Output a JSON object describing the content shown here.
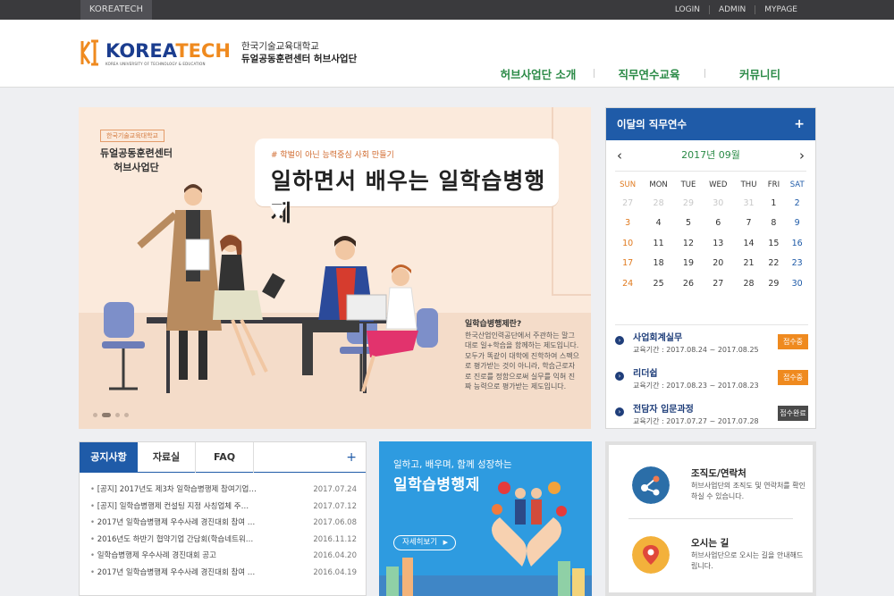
{
  "topbar": {
    "brand": "KOREATECH",
    "links": [
      "LOGIN",
      "ADMIN",
      "MYPAGE"
    ]
  },
  "logo": {
    "word_a": "KOREA",
    "word_b": "TECH",
    "sub": "KOREA UNIVERSITY OF TECHNOLOGY & EDUCATION",
    "kname1": "한국기술교육대학교",
    "kname2": "듀얼공동훈련센터 허브사업단"
  },
  "nav": [
    "허브사업단 소개",
    "직무연수교육",
    "커뮤니티"
  ],
  "hero": {
    "tag1": "한국기술교육대학교",
    "tag2a": "듀얼공동훈련센터",
    "tag2b": "허브사업단",
    "bubble_small": "# 학벌이 아닌 능력중심 사회 만들기",
    "bubble_big": "일하면서 배우는 일학습병행제",
    "info_title": "일학습병행제란?",
    "info_body": "한국산업인력공단에서 주관하는 말그대로 일+학습을 함께하는 제도입니다. 모두가 똑같이 대학에 진학하여 스펙으로 평가받는 것이 아니라, 학습근로자로 진로를 정함으로써 실무를 익혀 진짜 능력으로 평가받는 제도입니다."
  },
  "calendar": {
    "title": "이달의 직무연수",
    "plus": "+",
    "prev": "‹",
    "next": "›",
    "month": "2017년 09월",
    "days": [
      "SUN",
      "MON",
      "TUE",
      "WED",
      "THU",
      "FRI",
      "SAT"
    ],
    "weeks": [
      [
        "27",
        "28",
        "29",
        "30",
        "31",
        "1",
        "2"
      ],
      [
        "3",
        "4",
        "5",
        "6",
        "7",
        "8",
        "9"
      ],
      [
        "10",
        "11",
        "12",
        "13",
        "14",
        "15",
        "16"
      ],
      [
        "17",
        "18",
        "19",
        "20",
        "21",
        "22",
        "23"
      ],
      [
        "24",
        "25",
        "26",
        "27",
        "28",
        "29",
        "30"
      ]
    ],
    "items": [
      {
        "title": "사업회계실무",
        "date": "교육기간 : 2017.08.24 ~ 2017.08.25",
        "badge": "접수중"
      },
      {
        "title": "리더쉽",
        "date": "교육기간 : 2017.08.23 ~ 2017.08.23",
        "badge": "접수중"
      },
      {
        "title": "전담자 입문과정",
        "date": "교육기간 : 2017.07.27 ~ 2017.07.28",
        "badge": "접수완료"
      }
    ]
  },
  "board": {
    "tabs": [
      "공지사항",
      "자료실",
      "FAQ"
    ],
    "plus": "+",
    "rows": [
      {
        "title": "[공지] 2017년도 제3차 일학습병행제 참여기업…",
        "date": "2017.07.24"
      },
      {
        "title": "[공지] 일학습병행제 컨설팅 지정 사칭업체 주…",
        "date": "2017.07.12"
      },
      {
        "title": "2017년 일학습병행제 우수사례 경진대회 참여 …",
        "date": "2017.06.08"
      },
      {
        "title": "2016년도 하반기 협약기업 간담회(학습네트워…",
        "date": "2016.11.12"
      },
      {
        "title": "일학습병행제 우수사례 경진대회 공고",
        "date": "2016.04.20"
      },
      {
        "title": "2017년 일학습병행제 우수사례 경진대회 참여 …",
        "date": "2016.04.19"
      }
    ]
  },
  "promo": {
    "line1": "일하고, 배우며, 함께 성장하는",
    "line2": "일학습병행제",
    "button": "자세히보기",
    "arrow": "▶"
  },
  "quick": [
    {
      "title": "조직도/연락처",
      "desc": "허브사업단의 조직도 및 연락처를 확인하실 수 있습니다."
    },
    {
      "title": "오시는 길",
      "desc": "허브사업단으로 오시는 길을 안내해드립니다."
    }
  ],
  "colors": {
    "primary": "#1f5ba8",
    "green": "#2a8a46",
    "orange": "#ef8a1f"
  }
}
